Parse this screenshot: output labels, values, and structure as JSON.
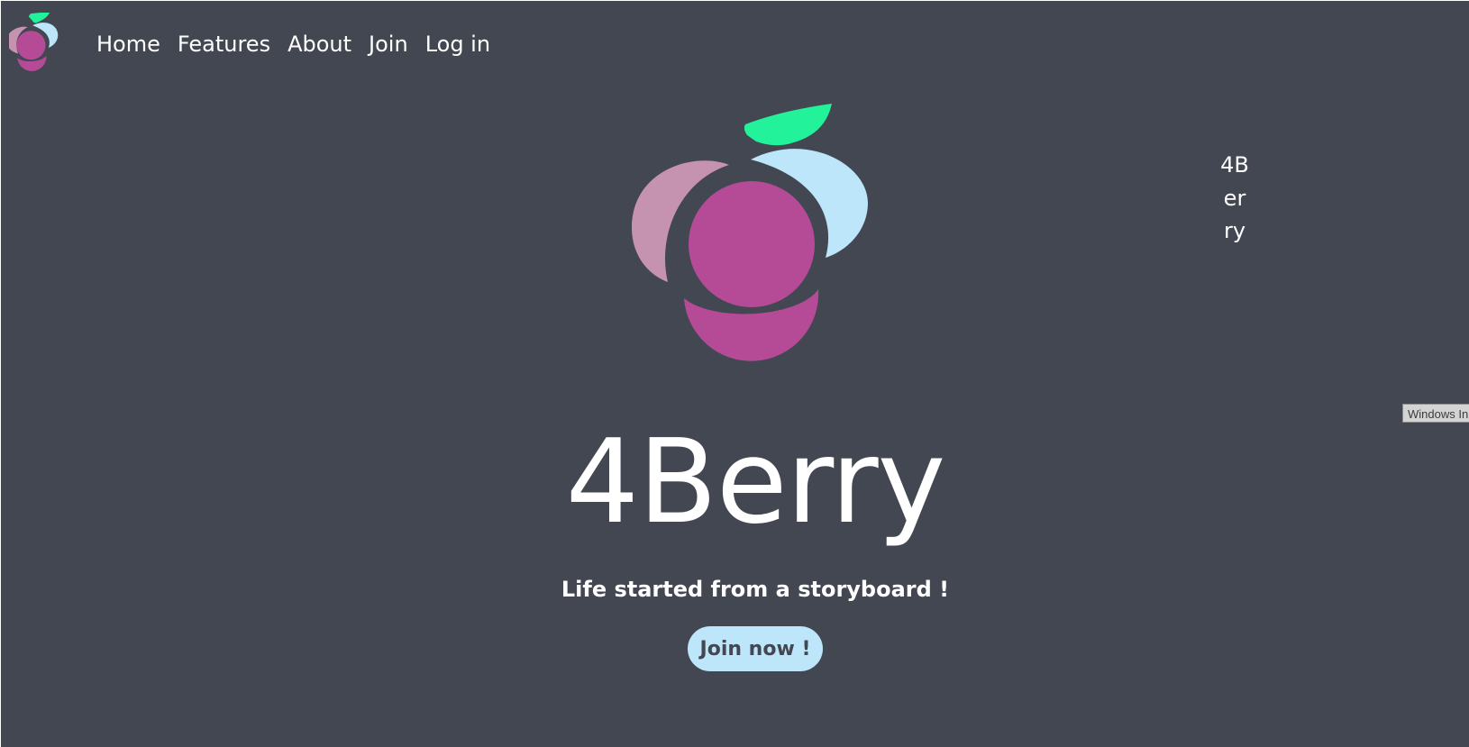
{
  "nav": {
    "logo_icon": "4berry-logo-icon",
    "links": [
      {
        "label": "Home"
      },
      {
        "label": "Features"
      },
      {
        "label": "About"
      },
      {
        "label": "Join"
      },
      {
        "label": "Log in"
      }
    ]
  },
  "hero": {
    "logo_icon": "4berry-berry-logo",
    "title": "4Berry",
    "tagline": "Life started from a storyboard !",
    "cta_label": "Join now !",
    "side_text": "4Berry"
  },
  "overlay": {
    "tooltip_text": "Windows In"
  },
  "colors": {
    "background": "#434752",
    "berry_main": "#b54b97",
    "berry_left": "#c593b0",
    "berry_right": "#bde6fb",
    "leaf": "#22f29a",
    "cta_bg": "#bde6fb",
    "text": "#ffffff"
  }
}
